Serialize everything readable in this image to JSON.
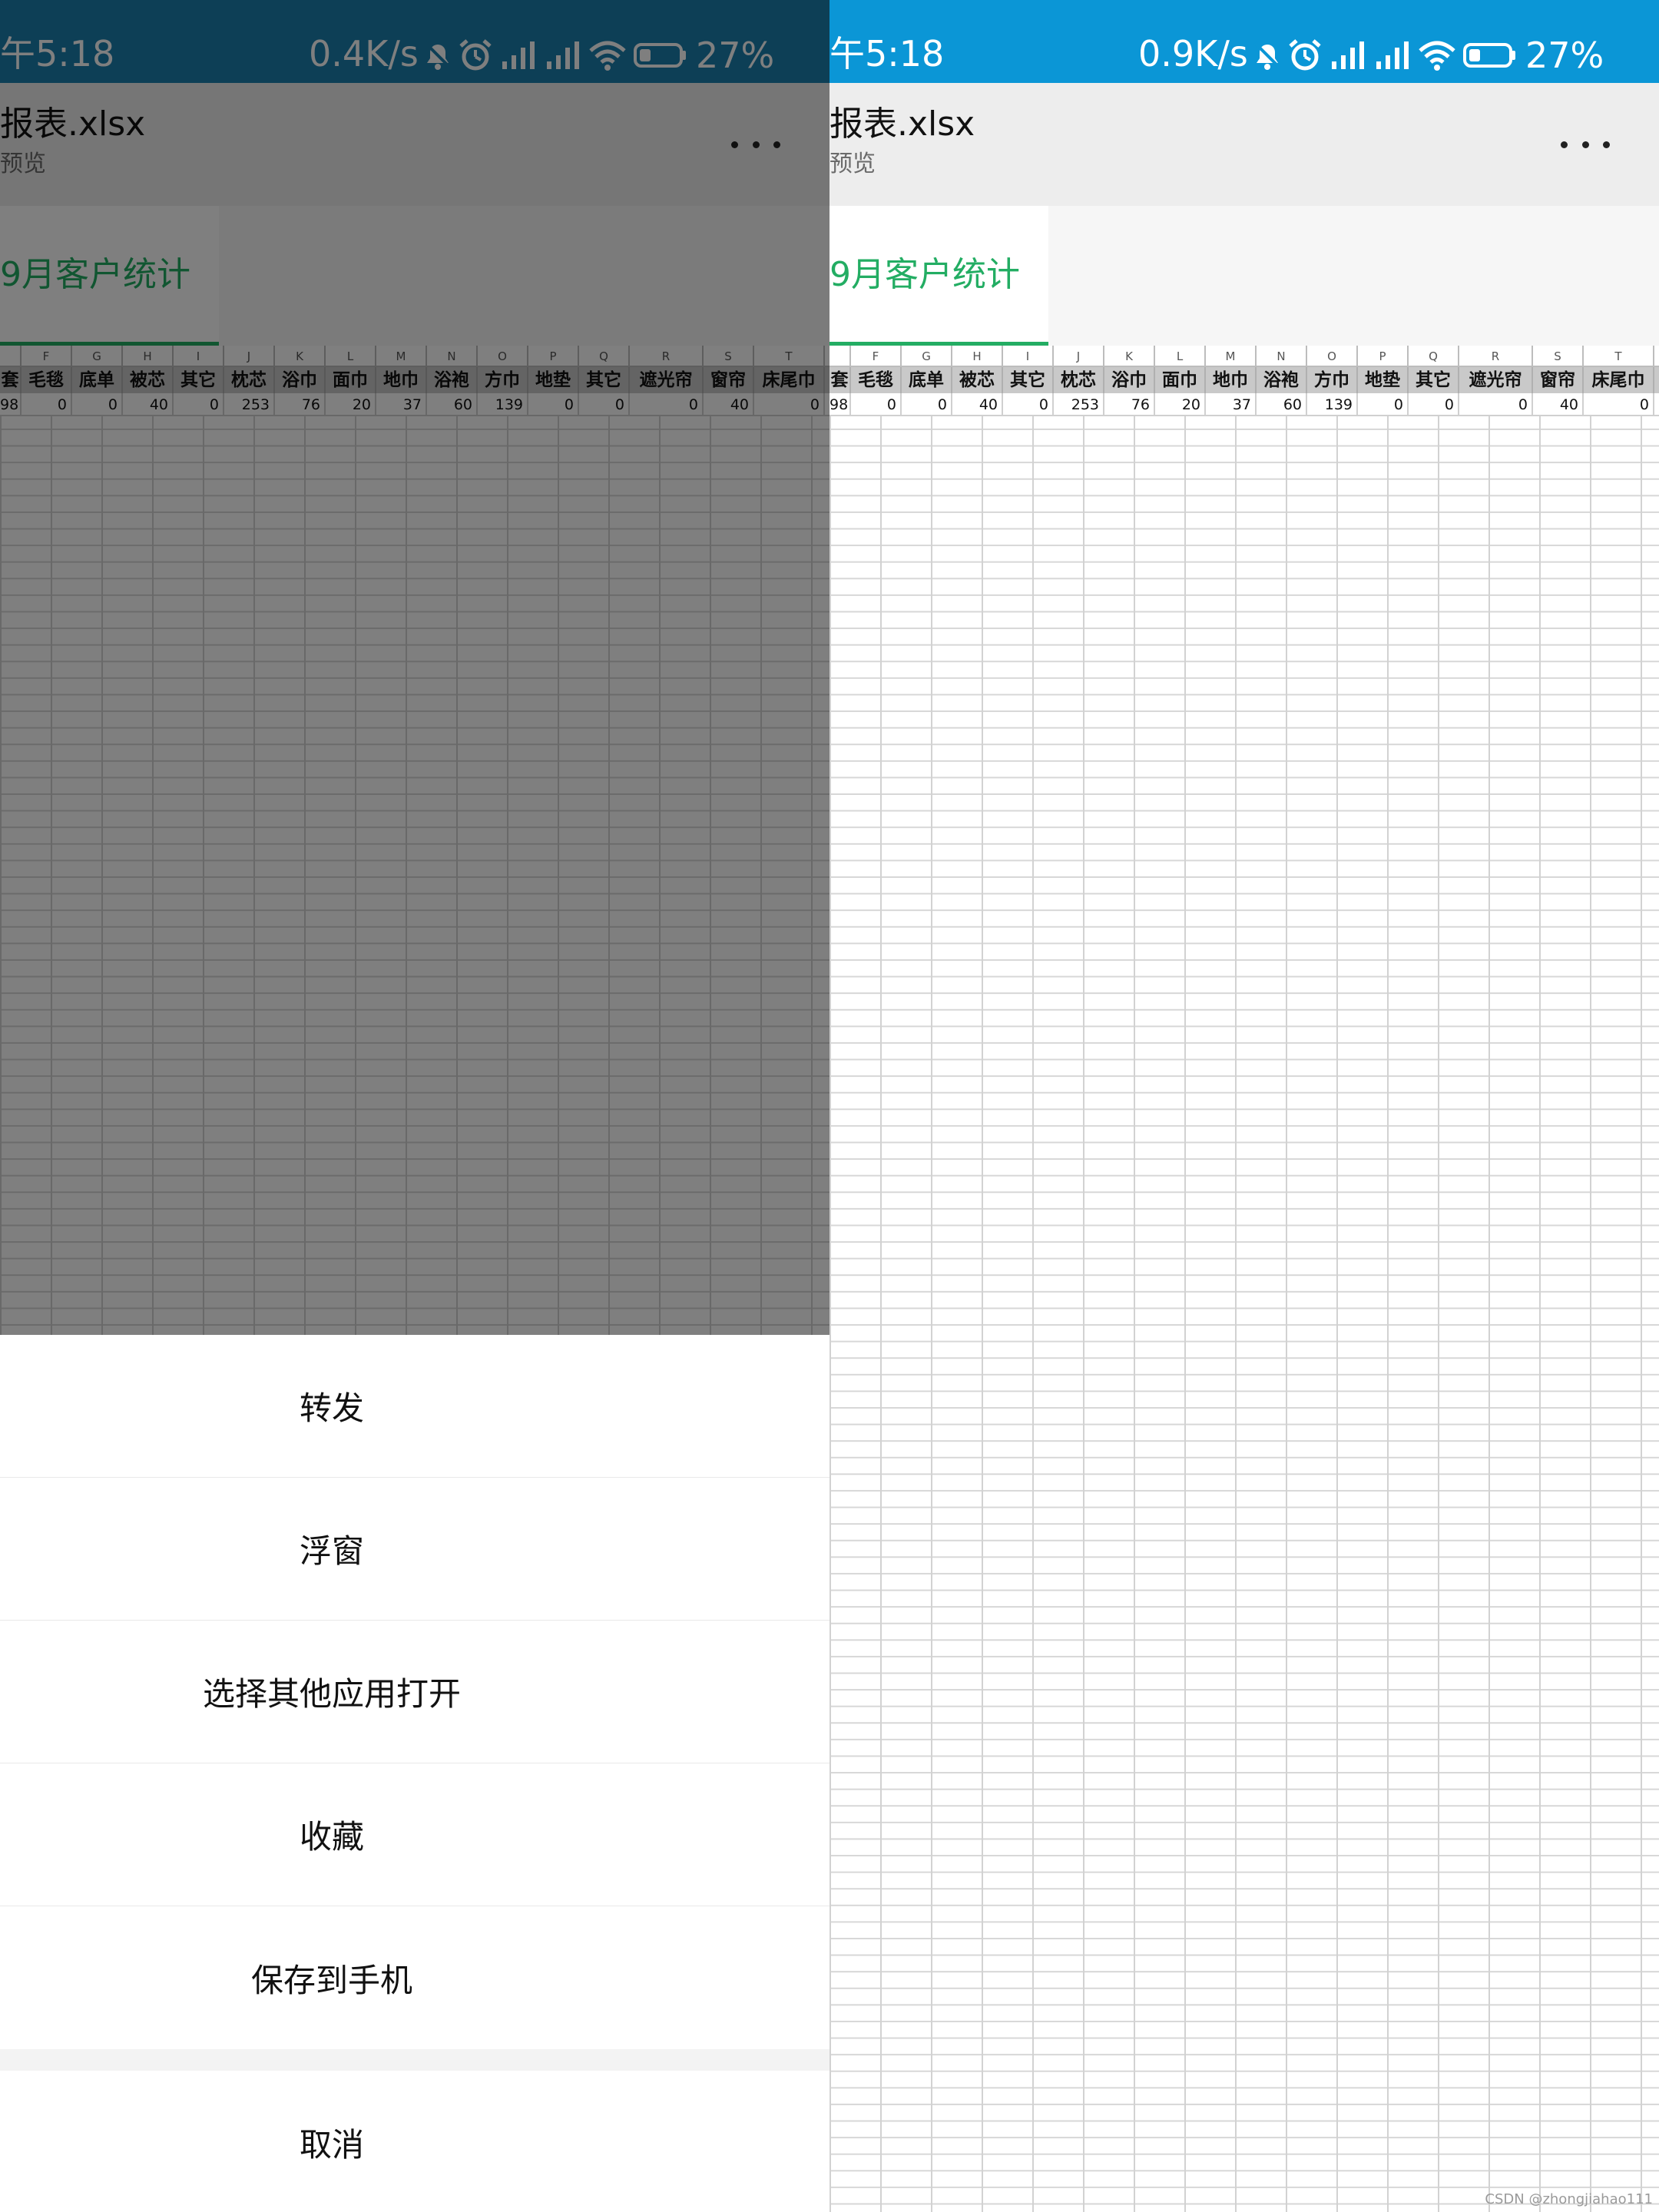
{
  "panels": {
    "left": {
      "status": {
        "time": "午5:18",
        "speed": "0.4K/s",
        "battery": "27%",
        "background": "#1a7fad"
      },
      "title": {
        "filename": "报表.xlsx",
        "subtitle": "预览"
      },
      "sheet_tab": "9月客户统计"
    },
    "right": {
      "status": {
        "time": "午5:18",
        "speed": "0.9K/s",
        "battery": "27%",
        "background": "#0b96d6"
      },
      "title": {
        "filename": "报表.xlsx",
        "subtitle": "预览"
      },
      "sheet_tab": "9月客户统计"
    }
  },
  "spreadsheet": {
    "left_cols": [
      {
        "letter": "",
        "header": "套",
        "value": "98"
      },
      {
        "letter": "F",
        "header": "毛毯",
        "value": "0"
      },
      {
        "letter": "G",
        "header": "底单",
        "value": "0"
      },
      {
        "letter": "H",
        "header": "被芯",
        "value": "40"
      },
      {
        "letter": "I",
        "header": "其它",
        "value": "0"
      },
      {
        "letter": "J",
        "header": "枕芯",
        "value": "253"
      },
      {
        "letter": "K",
        "header": "浴巾",
        "value": "76"
      },
      {
        "letter": "L",
        "header": "面巾",
        "value": "20"
      },
      {
        "letter": "M",
        "header": "地巾",
        "value": "37"
      },
      {
        "letter": "N",
        "header": "浴袍",
        "value": "60"
      },
      {
        "letter": "O",
        "header": "方巾",
        "value": "139"
      },
      {
        "letter": "P",
        "header": "地垫",
        "value": "0"
      },
      {
        "letter": "Q",
        "header": "其它",
        "value": "0"
      },
      {
        "letter": "R",
        "header": "遮光帘",
        "value": "0"
      },
      {
        "letter": "S",
        "header": "窗帘",
        "value": "40"
      },
      {
        "letter": "T",
        "header": "床尾巾",
        "value": "0"
      }
    ],
    "right_cols": [
      {
        "letter": "",
        "header": "套",
        "value": "98"
      },
      {
        "letter": "F",
        "header": "毛毯",
        "value": "0"
      },
      {
        "letter": "G",
        "header": "底单",
        "value": "0"
      },
      {
        "letter": "H",
        "header": "被芯",
        "value": "40"
      },
      {
        "letter": "I",
        "header": "其它",
        "value": "0"
      },
      {
        "letter": "J",
        "header": "枕芯",
        "value": "253"
      },
      {
        "letter": "K",
        "header": "浴巾",
        "value": "76"
      },
      {
        "letter": "L",
        "header": "面巾",
        "value": "20"
      },
      {
        "letter": "M",
        "header": "地巾",
        "value": "37"
      },
      {
        "letter": "N",
        "header": "浴袍",
        "value": "60"
      },
      {
        "letter": "O",
        "header": "方巾",
        "value": "139"
      },
      {
        "letter": "P",
        "header": "地垫",
        "value": "0"
      },
      {
        "letter": "Q",
        "header": "其它",
        "value": "0"
      },
      {
        "letter": "R",
        "header": "遮光帘",
        "value": "0"
      },
      {
        "letter": "S",
        "header": "窗帘",
        "value": "40"
      },
      {
        "letter": "T",
        "header": "床尾巾",
        "value": "0"
      }
    ]
  },
  "action_sheet": {
    "items": [
      "转发",
      "浮窗",
      "选择其他应用打开",
      "收藏",
      "保存到手机"
    ],
    "cancel": "取消"
  },
  "watermark": "CSDN @zhongjiahao111",
  "colors": {
    "accent_green": "#23ad63",
    "title_bar": "#ededed",
    "header_row": "#c9c9c9"
  }
}
